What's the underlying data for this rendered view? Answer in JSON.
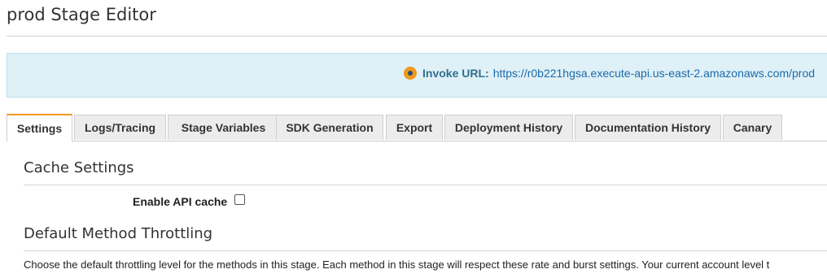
{
  "header": {
    "title": "prod Stage Editor"
  },
  "invoke": {
    "label": "Invoke URL:",
    "url": "https://r0b221hgsa.execute-api.us-east-2.amazonaws.com/prod",
    "icon": "info-dot-icon",
    "accent_color": "#f09a1c"
  },
  "tabs": [
    {
      "label": "Settings",
      "active": true
    },
    {
      "label": "Logs/Tracing",
      "active": false
    },
    {
      "label": "Stage Variables",
      "active": false
    },
    {
      "label": "SDK Generation",
      "active": false
    },
    {
      "label": "Export",
      "active": false
    },
    {
      "label": "Deployment History",
      "active": false
    },
    {
      "label": "Documentation History",
      "active": false
    },
    {
      "label": "Canary",
      "active": false
    }
  ],
  "cache": {
    "section_title": "Cache Settings",
    "enable_label": "Enable API cache",
    "enabled": false
  },
  "throttling": {
    "section_title": "Default Method Throttling",
    "description": "Choose the default throttling level for the methods in this stage. Each method in this stage will respect these rate and burst settings. Your current account level t"
  }
}
